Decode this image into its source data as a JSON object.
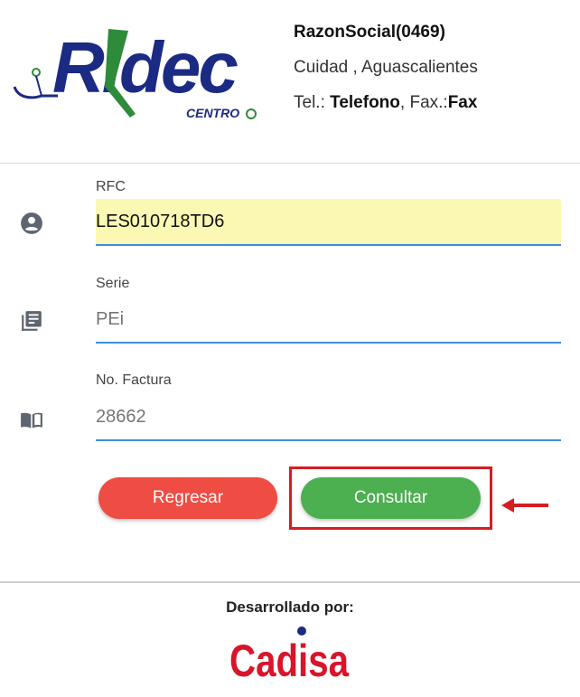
{
  "company": {
    "logo_text": "Ridec",
    "logo_sub": "CENTRO",
    "name": "RazonSocial(0469)",
    "location": "Cuidad , Aguascalientes",
    "tel_label": "Tel.:",
    "tel_value": "Telefono",
    "fax_label": ", Fax.:",
    "fax_value": "Fax"
  },
  "form": {
    "rfc": {
      "label": "RFC",
      "value": "LES010718TD6",
      "icon": "account-circle-icon"
    },
    "serie": {
      "label": "Serie",
      "placeholder": "PEi",
      "icon": "library-books-icon"
    },
    "factura": {
      "label": "No. Factura",
      "placeholder": "28662",
      "icon": "book-icon"
    }
  },
  "buttons": {
    "back_label": "Regresar",
    "query_label": "Consultar"
  },
  "colors": {
    "back": "#ef4c43",
    "query": "#4caf50",
    "input_underline": "#3b8fe0",
    "rfc_fill": "#fbf8b4",
    "annotation": "#d51d22"
  },
  "footer": {
    "developed_by": "Desarrollado por:",
    "brand": "Cadisa"
  }
}
